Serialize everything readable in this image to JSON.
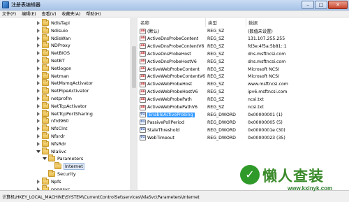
{
  "window": {
    "title": "注册表编辑器",
    "controls": {
      "minimize": "–",
      "maximize": "□",
      "close": "✕"
    }
  },
  "menubar": {
    "items": [
      "文件(F)",
      "编辑(E)",
      "查看(V)",
      "收藏夹(A)",
      "帮助(H)"
    ]
  },
  "tree": {
    "items": [
      {
        "label": "NdisTapi",
        "indent": 0,
        "state": "collapsed"
      },
      {
        "label": "Ndisuio",
        "indent": 0,
        "state": "collapsed"
      },
      {
        "label": "NdisWan",
        "indent": 0,
        "state": "collapsed"
      },
      {
        "label": "NDProxy",
        "indent": 0,
        "state": "collapsed"
      },
      {
        "label": "NetBIOS",
        "indent": 0,
        "state": "collapsed"
      },
      {
        "label": "NetBT",
        "indent": 0,
        "state": "collapsed"
      },
      {
        "label": "Netlogon",
        "indent": 0,
        "state": "collapsed"
      },
      {
        "label": "Netman",
        "indent": 0,
        "state": "collapsed"
      },
      {
        "label": "NetMsmqActivator",
        "indent": 0,
        "state": "collapsed"
      },
      {
        "label": "NetPipeActivator",
        "indent": 0,
        "state": "collapsed"
      },
      {
        "label": "netprofm",
        "indent": 0,
        "state": "collapsed"
      },
      {
        "label": "NetTcpActivator",
        "indent": 0,
        "state": "collapsed"
      },
      {
        "label": "NetTcpPortSharing",
        "indent": 0,
        "state": "collapsed"
      },
      {
        "label": "nfrd960",
        "indent": 0,
        "state": "collapsed"
      },
      {
        "label": "NfsClnt",
        "indent": 0,
        "state": "collapsed"
      },
      {
        "label": "Nfsrdr",
        "indent": 0,
        "state": "collapsed"
      },
      {
        "label": "NfsRdr",
        "indent": 0,
        "state": "collapsed"
      },
      {
        "label": "NlaSvc",
        "indent": 0,
        "state": "expanded"
      },
      {
        "label": "Parameters",
        "indent": 1,
        "state": "expanded"
      },
      {
        "label": "Internet",
        "indent": 2,
        "state": "none",
        "selected": true
      },
      {
        "label": "Security",
        "indent": 1,
        "state": "none"
      },
      {
        "label": "Npfs",
        "indent": 0,
        "state": "collapsed"
      },
      {
        "label": "npggsvc",
        "indent": 0,
        "state": "collapsed"
      },
      {
        "label": "nsi",
        "indent": 0,
        "state": "collapsed"
      },
      {
        "label": "nsiproxy",
        "indent": 0,
        "state": "collapsed"
      }
    ]
  },
  "values": {
    "columns": {
      "name": "名称",
      "type": "类型",
      "data": "数据"
    },
    "rows": [
      {
        "icon": "ab",
        "kind": "sz",
        "name": "(默认)",
        "type": "REG_SZ",
        "data": "(数值未设置)"
      },
      {
        "icon": "ab",
        "kind": "sz",
        "name": "ActiveDnsProbeContent",
        "type": "REG_SZ",
        "data": "131.107.255.255"
      },
      {
        "icon": "ab",
        "kind": "sz",
        "name": "ActiveDnsProbeContentV6",
        "type": "REG_SZ",
        "data": "fd3e:4f5a:5b81::1"
      },
      {
        "icon": "ab",
        "kind": "sz",
        "name": "ActiveDnsProbeHost",
        "type": "REG_SZ",
        "data": "dns.msftncsi.com"
      },
      {
        "icon": "ab",
        "kind": "sz",
        "name": "ActiveDnsProbeHostV6",
        "type": "REG_SZ",
        "data": "dns.msftncsi.com"
      },
      {
        "icon": "ab",
        "kind": "sz",
        "name": "ActiveWebProbeContent",
        "type": "REG_SZ",
        "data": "Microsoft NCSI"
      },
      {
        "icon": "ab",
        "kind": "sz",
        "name": "ActiveWebProbeContentV6",
        "type": "REG_SZ",
        "data": "Microsoft NCSI"
      },
      {
        "icon": "ab",
        "kind": "sz",
        "name": "ActiveWebProbeHost",
        "type": "REG_SZ",
        "data": "www.msftncsi.com"
      },
      {
        "icon": "ab",
        "kind": "sz",
        "name": "ActiveWebProbeHostV6",
        "type": "REG_SZ",
        "data": "ipv6.msftncsi.com"
      },
      {
        "icon": "ab",
        "kind": "sz",
        "name": "ActiveWebProbePath",
        "type": "REG_SZ",
        "data": "ncsi.txt"
      },
      {
        "icon": "ab",
        "kind": "sz",
        "name": "ActiveWebProbePathV6",
        "type": "REG_SZ",
        "data": "ncsi.txt"
      },
      {
        "icon": "01",
        "kind": "dword",
        "name": "EnableActiveProbing",
        "type": "REG_DWORD",
        "data": "0x00000001 (1)",
        "selected": true
      },
      {
        "icon": "01",
        "kind": "dword",
        "name": "PassivePollPeriod",
        "type": "REG_DWORD",
        "data": "0x00000005 (5)"
      },
      {
        "icon": "01",
        "kind": "dword",
        "name": "StaleThreshold",
        "type": "REG_DWORD",
        "data": "0x0000001e (30)"
      },
      {
        "icon": "01",
        "kind": "dword",
        "name": "WebTimeout",
        "type": "REG_DWORD",
        "data": "0x00000023 (35)"
      }
    ]
  },
  "statusbar": {
    "path": "计算机\\HKEY_LOCAL_MACHINE\\SYSTEM\\CurrentControlSet\\services\\NlaSvc\\Parameters\\Internet"
  },
  "watermark": {
    "mark": "✓",
    "title": "懒人查装",
    "url": "www.kxinyk.com"
  },
  "icons": {
    "app": "registry-editor-icon",
    "tree_node": "folder-icon",
    "string_value": "string-value-icon",
    "dword_value": "dword-value-icon"
  },
  "colors": {
    "selection": "#3399ff",
    "titlebar": "#b8cfee",
    "watermark": "#2f9a2a"
  }
}
